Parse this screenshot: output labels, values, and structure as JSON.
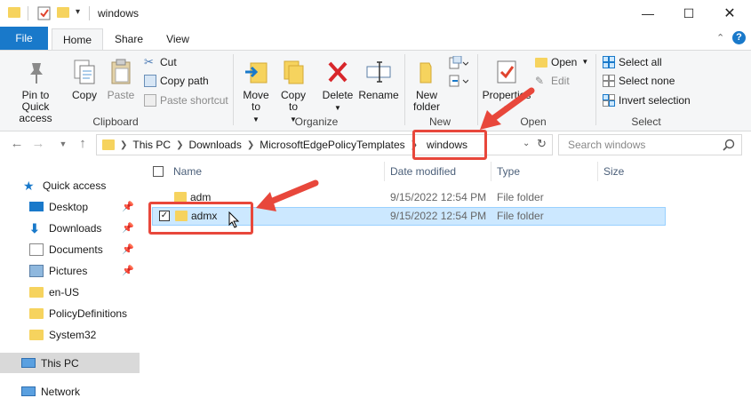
{
  "window": {
    "title": "windows",
    "controls": [
      "minimize",
      "maximize",
      "close"
    ]
  },
  "ribbon": {
    "tabs": [
      "File",
      "Home",
      "Share",
      "View"
    ],
    "active_tab": "Home",
    "clipboard": {
      "label": "Clipboard",
      "pin": "Pin to Quick access",
      "copy": "Copy",
      "paste": "Paste",
      "cut": "Cut",
      "copy_path": "Copy path",
      "paste_shortcut": "Paste shortcut"
    },
    "organize": {
      "label": "Organize",
      "move_to": "Move to",
      "copy_to": "Copy to",
      "delete": "Delete",
      "rename": "Rename"
    },
    "new": {
      "label": "New",
      "new_folder": "New folder"
    },
    "open": {
      "label": "Open",
      "properties": "Properties",
      "open": "Open",
      "edit": "Edit"
    },
    "select": {
      "label": "Select",
      "select_all": "Select all",
      "select_none": "Select none",
      "invert": "Invert selection"
    }
  },
  "address": {
    "crumbs": [
      "This PC",
      "Downloads",
      "MicrosoftEdgePolicyTemplates",
      "windows"
    ],
    "search_placeholder": "Search windows"
  },
  "nav": {
    "quick_access": "Quick access",
    "items": [
      {
        "label": "Desktop",
        "icon": "desktop-icon",
        "pinned": true
      },
      {
        "label": "Downloads",
        "icon": "download-icon",
        "pinned": true
      },
      {
        "label": "Documents",
        "icon": "documents-icon",
        "pinned": true
      },
      {
        "label": "Pictures",
        "icon": "pictures-icon",
        "pinned": true
      },
      {
        "label": "en-US",
        "icon": "folder-icon",
        "pinned": false
      },
      {
        "label": "PolicyDefinitions",
        "icon": "folder-icon",
        "pinned": false
      },
      {
        "label": "System32",
        "icon": "folder-icon",
        "pinned": false
      }
    ],
    "this_pc": "This PC",
    "network": "Network"
  },
  "files": {
    "columns": [
      "Name",
      "Date modified",
      "Type",
      "Size"
    ],
    "rows": [
      {
        "name": "adm",
        "date": "9/15/2022 12:54 PM",
        "type": "File folder",
        "size": "",
        "selected": false
      },
      {
        "name": "admx",
        "date": "9/15/2022 12:54 PM",
        "type": "File folder",
        "size": "",
        "selected": true
      }
    ]
  },
  "colors": {
    "accent": "#1979ca",
    "selection": "#cce8ff",
    "annotation": "#e8473b",
    "folder": "#f6d35e"
  }
}
